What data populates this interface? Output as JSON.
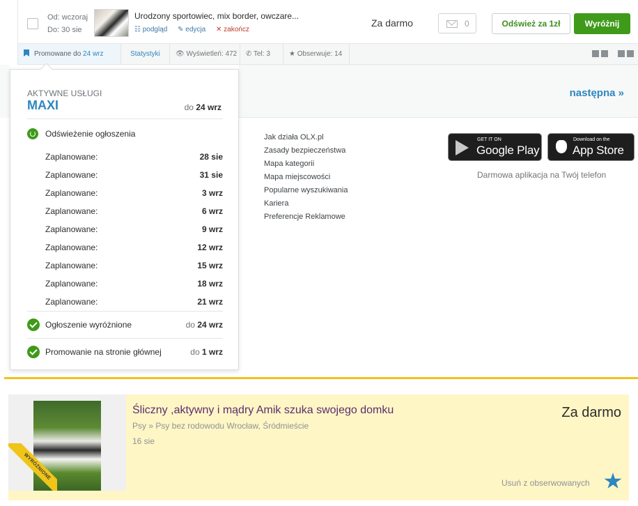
{
  "listing": {
    "from_label": "Od: wczoraj",
    "to_label": "Do: 30 sie",
    "title": "Urodzony sportowiec, mix border, owczare...",
    "actions": {
      "preview": "podgląd",
      "edit": "edycja",
      "end": "zakończ"
    },
    "price": "Za darmo",
    "messages_count": "0",
    "refresh_button": "Odśwież za 1zł",
    "feature_button": "Wyróżnij"
  },
  "statsbar": {
    "promo_label": "Promowane do ",
    "promo_date": "24 wrz",
    "stats_link": "Statystyki",
    "views": "Wyświetleń: 472",
    "phone": "Tel: 3",
    "watchers": "Obserwuje: 14"
  },
  "popover": {
    "heading": "AKTYWNE USŁUGI",
    "plan": "MAXI",
    "plan_to_prefix": "do ",
    "plan_to_date": "24 wrz",
    "refresh_service": "Odświeżenie ogłoszenia",
    "schedule": [
      {
        "label": "Zaplanowane:",
        "date": "28 sie"
      },
      {
        "label": "Zaplanowane:",
        "date": "31 sie"
      },
      {
        "label": "Zaplanowane:",
        "date": "3 wrz"
      },
      {
        "label": "Zaplanowane:",
        "date": "6 wrz"
      },
      {
        "label": "Zaplanowane:",
        "date": "9 wrz"
      },
      {
        "label": "Zaplanowane:",
        "date": "12 wrz"
      },
      {
        "label": "Zaplanowane:",
        "date": "15 wrz"
      },
      {
        "label": "Zaplanowane:",
        "date": "18 wrz"
      },
      {
        "label": "Zaplanowane:",
        "date": "21 wrz"
      }
    ],
    "featured": {
      "label": "Ogłoszenie wyróżnione",
      "prefix": "do ",
      "date": "24 wrz"
    },
    "homepage": {
      "label": "Promowanie na stronie głównej",
      "prefix": "do ",
      "date": "1 wrz"
    }
  },
  "pager": {
    "next": "następna »"
  },
  "footer": {
    "links": [
      "Jak działa OLX.pl",
      "Zasady bezpieczeństwa",
      "Mapa kategorii",
      "Mapa miejscowości",
      "Popularne wyszukiwania",
      "Kariera",
      "Preferencje Reklamowe"
    ],
    "google_small": "GET IT ON",
    "google_big": "Google Play",
    "apple_small": "Download on the",
    "apple_big": "App Store",
    "app_text": "Darmowa aplikacja na Twój telefon"
  },
  "card": {
    "ribbon": "WYRÓŻNIONE",
    "title": "Śliczny ,aktywny i mądry Amik szuka swojego domku",
    "category": "Psy » Psy bez rodowodu Wrocław, Śródmieście",
    "date": "16 sie",
    "price": "Za darmo",
    "unwatch": "Usuń z obserwowanych"
  },
  "colors": {
    "accent_blue": "#2e86c0",
    "accent_green": "#3f9a1a",
    "featured_yellow": "#f0c419",
    "card_bg": "#fff6c5"
  }
}
